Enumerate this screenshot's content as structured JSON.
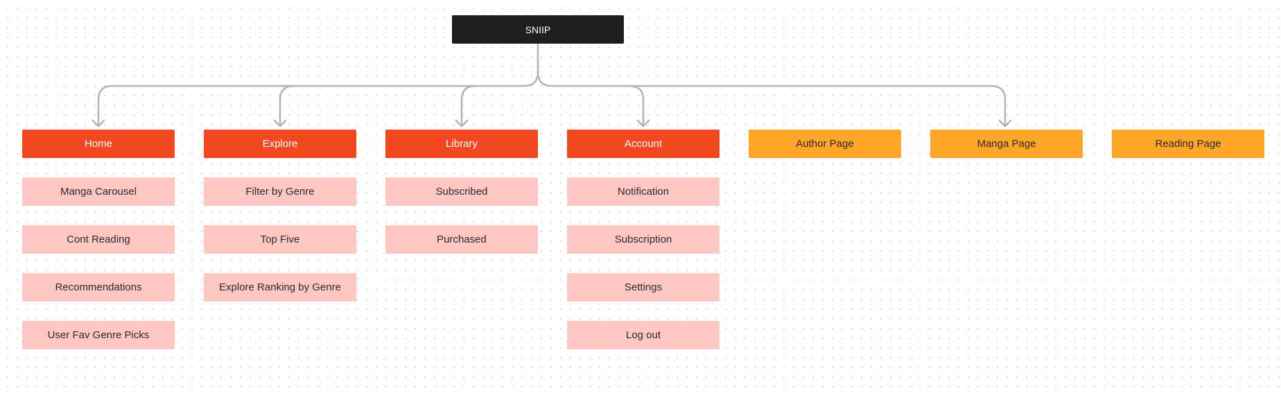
{
  "root": {
    "label": "SNIIP"
  },
  "sections": [
    {
      "label": "Home",
      "type": "primary",
      "children": [
        "Manga Carousel",
        "Cont Reading",
        "Recommendations",
        "User Fav Genre Picks"
      ]
    },
    {
      "label": "Explore",
      "type": "primary",
      "children": [
        "Filter by Genre",
        "Top Five",
        "Explore Ranking by Genre"
      ]
    },
    {
      "label": "Library",
      "type": "primary",
      "children": [
        "Subscribed",
        "Purchased"
      ]
    },
    {
      "label": "Account",
      "type": "primary",
      "children": [
        "Notification",
        "Subscription",
        "Settings",
        "Log out"
      ]
    },
    {
      "label": "Author Page",
      "type": "page",
      "children": []
    },
    {
      "label": "Manga Page",
      "type": "page",
      "children": []
    },
    {
      "label": "Reading Page",
      "type": "page",
      "children": []
    }
  ],
  "connections": [
    "Home",
    "Explore",
    "Library",
    "Account",
    "Manga Page"
  ],
  "colors": {
    "root": "#1e1e1e",
    "primary": "#f24822",
    "page": "#ffa629",
    "child": "#ffc7c2",
    "connector": "#b3b3b3"
  }
}
